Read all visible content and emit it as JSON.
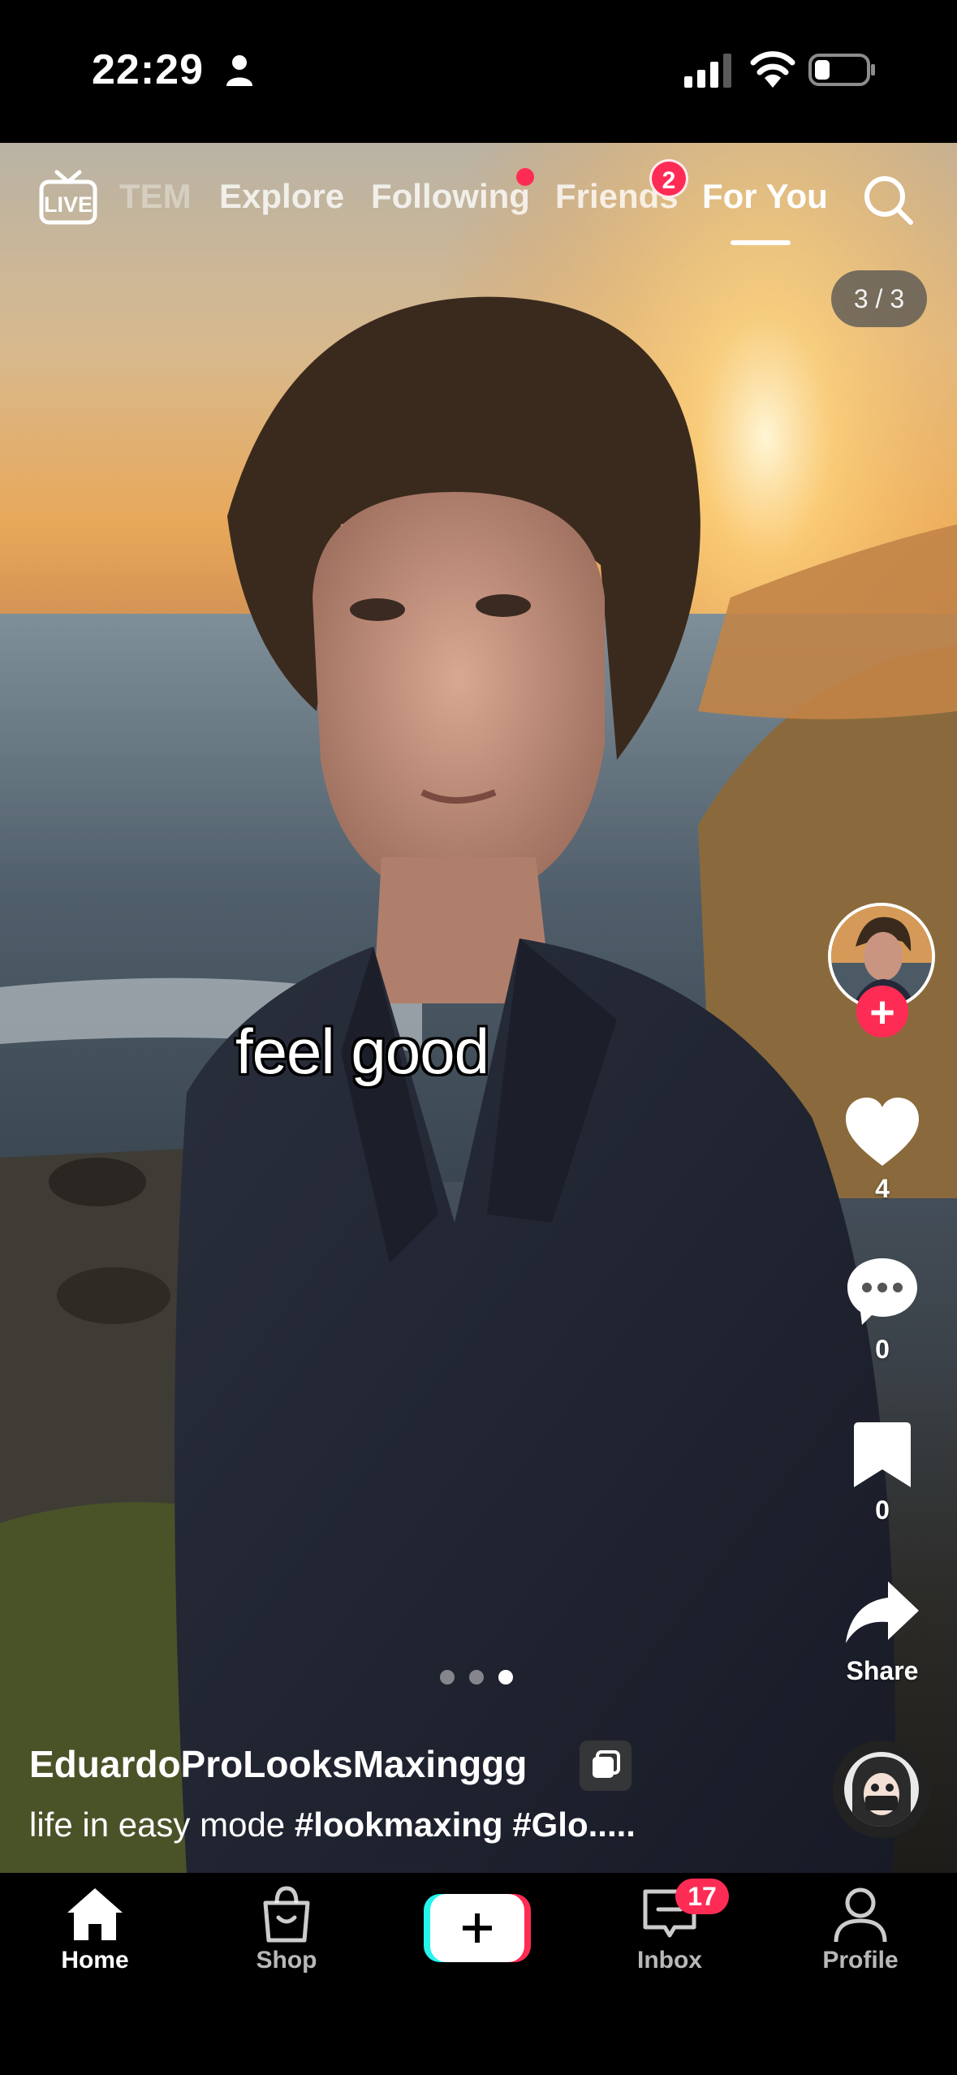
{
  "status_bar": {
    "time": "22:29"
  },
  "top_nav": {
    "tabs": [
      {
        "label": "TEM"
      },
      {
        "label": "Explore"
      },
      {
        "label": "Following"
      },
      {
        "label": "Friends"
      },
      {
        "label": "For You"
      }
    ],
    "friends_badge": "2",
    "active_tab": "For You"
  },
  "post": {
    "page_counter": "3 / 3",
    "caption_overlay": "feel good",
    "likes": "4",
    "comments": "0",
    "saves": "0",
    "share_label": "Share",
    "username": "EduardoProLooksMaxinggg",
    "description_text": "life in easy mode ",
    "description_tags": "#lookmaxing #Glo.....",
    "carousel": {
      "total": 3,
      "active_index": 2
    }
  },
  "bottom_nav": {
    "items": [
      {
        "label": "Home",
        "icon": "home-icon"
      },
      {
        "label": "Shop",
        "icon": "shop-bag-icon"
      },
      {
        "label": "",
        "icon": "plus-icon"
      },
      {
        "label": "Inbox",
        "icon": "inbox-icon"
      },
      {
        "label": "Profile",
        "icon": "profile-icon"
      }
    ],
    "inbox_badge": "17"
  },
  "colors": {
    "accent": "#fe2c55",
    "cyan": "#25f4ee",
    "background": "#000000"
  }
}
